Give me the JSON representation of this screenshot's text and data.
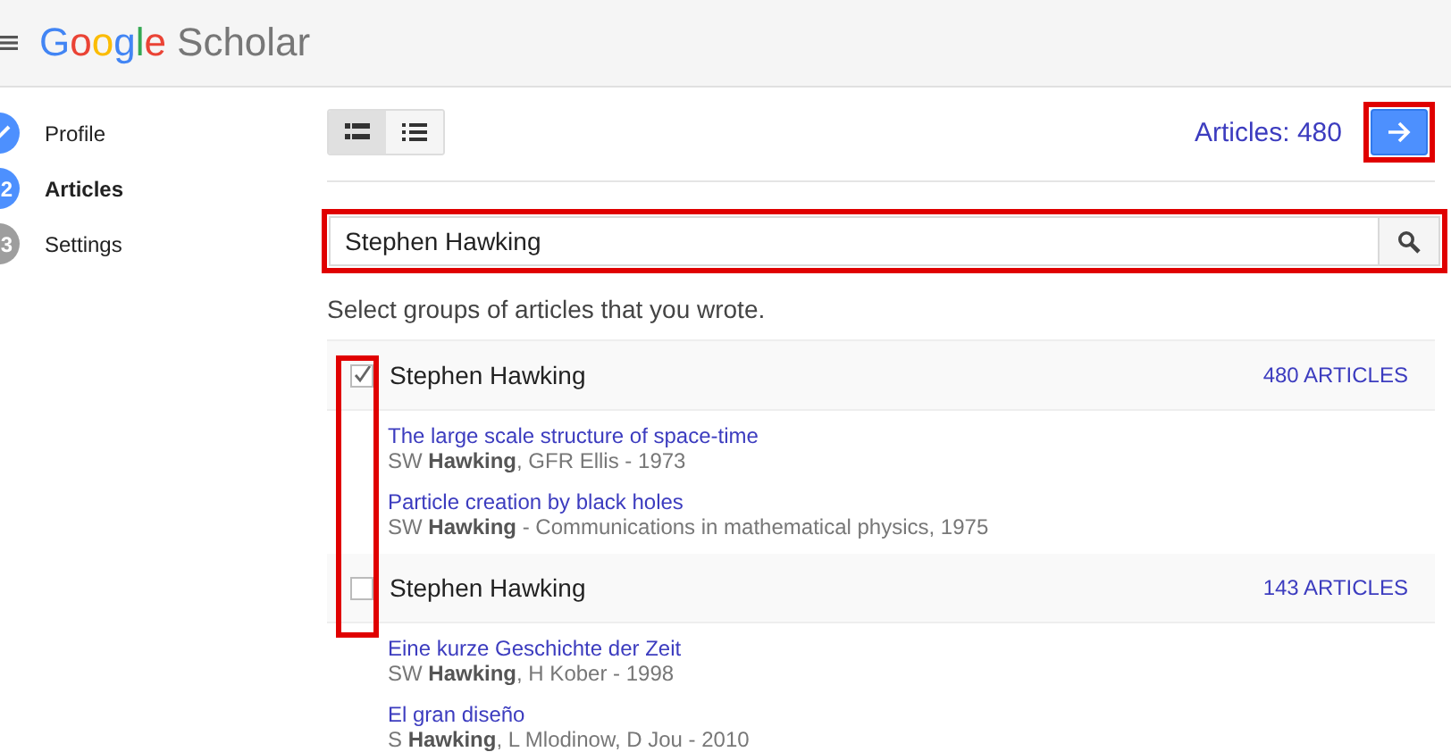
{
  "header": {
    "logo_google": "Google",
    "logo_product": "Scholar"
  },
  "steps": [
    {
      "label": "Profile",
      "completed": true,
      "current": false
    },
    {
      "number": "2",
      "label": "Articles",
      "completed": false,
      "current": true
    },
    {
      "number": "3",
      "label": "Settings",
      "completed": false,
      "current": false
    }
  ],
  "view_toggle": [
    {
      "kind": "detailed",
      "selected": true
    },
    {
      "kind": "compact",
      "selected": false
    }
  ],
  "article_count": "Articles: 480",
  "next_button": {
    "highlighted": true
  },
  "search": {
    "value": "Stephen Hawking",
    "highlighted": true
  },
  "hint": "Select groups of articles that you wrote.",
  "checkbox_column_highlighted": true,
  "groups": [
    {
      "name": "Stephen Hawking",
      "checked": true,
      "count": "480 ARTICLES",
      "articles": [
        {
          "title": "The large scale structure of space-time",
          "meta": "SW **Hawking**, GFR Ellis - 1973"
        },
        {
          "title": "Particle creation by black holes",
          "meta": "SW **Hawking** - Communications in mathematical physics, 1975"
        }
      ]
    },
    {
      "name": "Stephen Hawking",
      "checked": false,
      "count": "143 ARTICLES",
      "articles": [
        {
          "title": "Eine kurze Geschichte der Zeit",
          "meta": "SW **Hawking**, H Kober - 1998"
        },
        {
          "title": "El gran diseño",
          "meta": "S **Hawking**, L Mlodinow, D Jou - 2010"
        }
      ]
    }
  ]
}
